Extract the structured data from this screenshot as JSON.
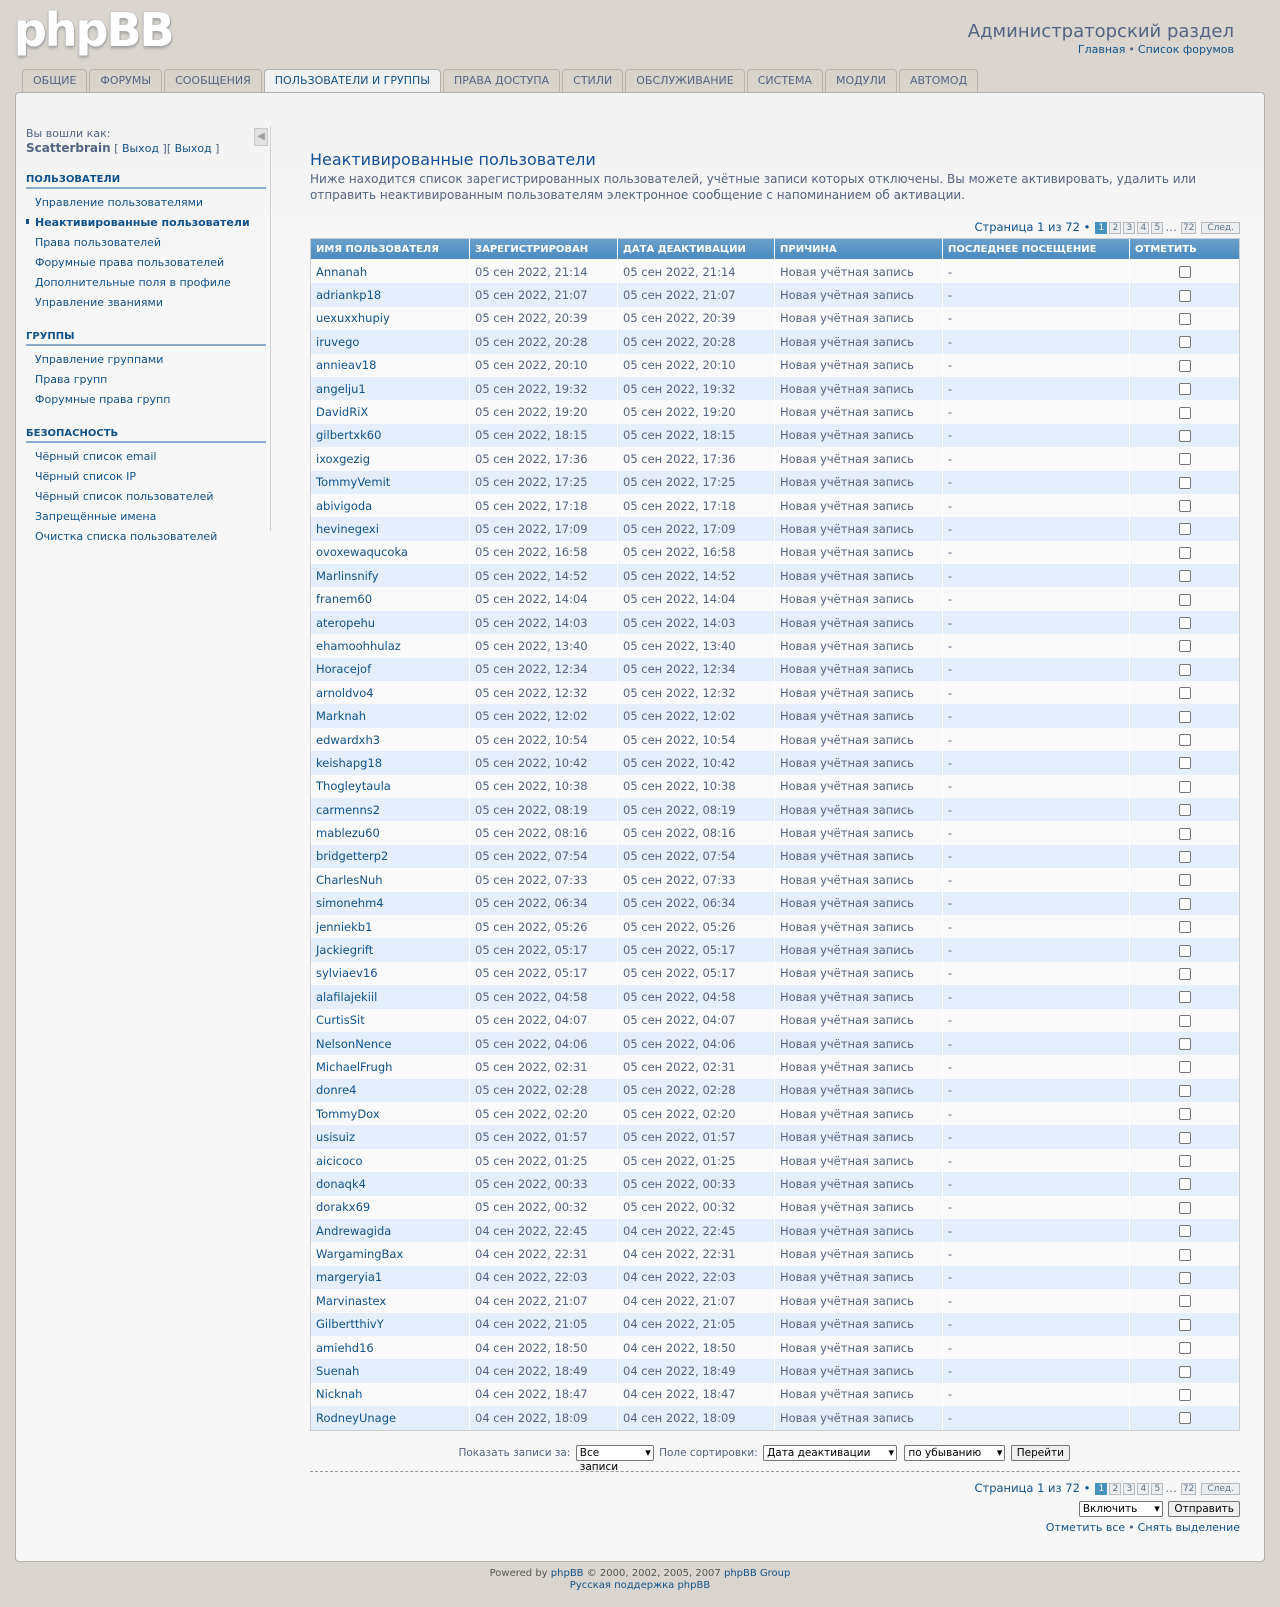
{
  "header": {
    "logo": "phpBB",
    "title": "Администраторский раздел",
    "links": [
      "Главная",
      "Список форумов"
    ]
  },
  "tabs": [
    "Общие",
    "Форумы",
    "Сообщения",
    "Пользователи и группы",
    "Права доступа",
    "Стили",
    "Обслуживание",
    "Система",
    "Модули",
    "Автомод"
  ],
  "active_tab": 3,
  "sidebar": {
    "logged_in_label": "Вы вошли как:",
    "username": "Scatterbrain",
    "logout_1": "Выход",
    "logout_2": "Выход",
    "sections": [
      {
        "title": "Пользователи",
        "items": [
          "Управление пользователями",
          "Неактивированные пользователи",
          "Права пользователей",
          "Форумные права пользователей",
          "Дополнительные поля в профиле",
          "Управление званиями"
        ]
      },
      {
        "title": "Группы",
        "items": [
          "Управление группами",
          "Права групп",
          "Форумные права групп"
        ]
      },
      {
        "title": "Безопасность",
        "items": [
          "Чёрный список email",
          "Чёрный список IP",
          "Чёрный список пользователей",
          "Запрещённые имена",
          "Очистка списка пользователей"
        ]
      }
    ],
    "active_item": "Неактивированные пользователи"
  },
  "main": {
    "title": "Неактивированные пользователи",
    "description": "Ниже находится список зарегистрированных пользователей, учётные записи которых отключены. Вы можете активировать, удалить или отправить неактивированным пользователям электронное сообщение с напоминанием об активации.",
    "pagination": {
      "label": "Страница 1 из 72 •",
      "pages": [
        "1",
        "2",
        "3",
        "4",
        "5"
      ],
      "dots": "…",
      "last": "72",
      "next": "След."
    },
    "columns": [
      "Имя пользователя",
      "Зарегистрирован",
      "Дата деактивации",
      "Причина",
      "Последнее посещение",
      "Отметить"
    ],
    "rows": [
      [
        "Annanah",
        "05 сен 2022, 21:14",
        "05 сен 2022, 21:14",
        "Новая учётная запись",
        "-"
      ],
      [
        "adriankp18",
        "05 сен 2022, 21:07",
        "05 сен 2022, 21:07",
        "Новая учётная запись",
        "-"
      ],
      [
        "uexuxxhupiy",
        "05 сен 2022, 20:39",
        "05 сен 2022, 20:39",
        "Новая учётная запись",
        "-"
      ],
      [
        "iruvego",
        "05 сен 2022, 20:28",
        "05 сен 2022, 20:28",
        "Новая учётная запись",
        "-"
      ],
      [
        "annieav18",
        "05 сен 2022, 20:10",
        "05 сен 2022, 20:10",
        "Новая учётная запись",
        "-"
      ],
      [
        "angelju1",
        "05 сен 2022, 19:32",
        "05 сен 2022, 19:32",
        "Новая учётная запись",
        "-"
      ],
      [
        "DavidRiX",
        "05 сен 2022, 19:20",
        "05 сен 2022, 19:20",
        "Новая учётная запись",
        "-"
      ],
      [
        "gilbertxk60",
        "05 сен 2022, 18:15",
        "05 сен 2022, 18:15",
        "Новая учётная запись",
        "-"
      ],
      [
        "ixoxgezig",
        "05 сен 2022, 17:36",
        "05 сен 2022, 17:36",
        "Новая учётная запись",
        "-"
      ],
      [
        "TommyVemit",
        "05 сен 2022, 17:25",
        "05 сен 2022, 17:25",
        "Новая учётная запись",
        "-"
      ],
      [
        "abivigoda",
        "05 сен 2022, 17:18",
        "05 сен 2022, 17:18",
        "Новая учётная запись",
        "-"
      ],
      [
        "hevinegexi",
        "05 сен 2022, 17:09",
        "05 сен 2022, 17:09",
        "Новая учётная запись",
        "-"
      ],
      [
        "ovoxewaqucoka",
        "05 сен 2022, 16:58",
        "05 сен 2022, 16:58",
        "Новая учётная запись",
        "-"
      ],
      [
        "Marlinsnify",
        "05 сен 2022, 14:52",
        "05 сен 2022, 14:52",
        "Новая учётная запись",
        "-"
      ],
      [
        "franem60",
        "05 сен 2022, 14:04",
        "05 сен 2022, 14:04",
        "Новая учётная запись",
        "-"
      ],
      [
        "ateropehu",
        "05 сен 2022, 14:03",
        "05 сен 2022, 14:03",
        "Новая учётная запись",
        "-"
      ],
      [
        "ehamoohhulaz",
        "05 сен 2022, 13:40",
        "05 сен 2022, 13:40",
        "Новая учётная запись",
        "-"
      ],
      [
        "Horacejof",
        "05 сен 2022, 12:34",
        "05 сен 2022, 12:34",
        "Новая учётная запись",
        "-"
      ],
      [
        "arnoldvo4",
        "05 сен 2022, 12:32",
        "05 сен 2022, 12:32",
        "Новая учётная запись",
        "-"
      ],
      [
        "Marknah",
        "05 сен 2022, 12:02",
        "05 сен 2022, 12:02",
        "Новая учётная запись",
        "-"
      ],
      [
        "edwardxh3",
        "05 сен 2022, 10:54",
        "05 сен 2022, 10:54",
        "Новая учётная запись",
        "-"
      ],
      [
        "keishapg18",
        "05 сен 2022, 10:42",
        "05 сен 2022, 10:42",
        "Новая учётная запись",
        "-"
      ],
      [
        "Thogleytaula",
        "05 сен 2022, 10:38",
        "05 сен 2022, 10:38",
        "Новая учётная запись",
        "-"
      ],
      [
        "carmenns2",
        "05 сен 2022, 08:19",
        "05 сен 2022, 08:19",
        "Новая учётная запись",
        "-"
      ],
      [
        "mablezu60",
        "05 сен 2022, 08:16",
        "05 сен 2022, 08:16",
        "Новая учётная запись",
        "-"
      ],
      [
        "bridgetterp2",
        "05 сен 2022, 07:54",
        "05 сен 2022, 07:54",
        "Новая учётная запись",
        "-"
      ],
      [
        "CharlesNuh",
        "05 сен 2022, 07:33",
        "05 сен 2022, 07:33",
        "Новая учётная запись",
        "-"
      ],
      [
        "simonehm4",
        "05 сен 2022, 06:34",
        "05 сен 2022, 06:34",
        "Новая учётная запись",
        "-"
      ],
      [
        "jenniekb1",
        "05 сен 2022, 05:26",
        "05 сен 2022, 05:26",
        "Новая учётная запись",
        "-"
      ],
      [
        "Jackiegrift",
        "05 сен 2022, 05:17",
        "05 сен 2022, 05:17",
        "Новая учётная запись",
        "-"
      ],
      [
        "sylviaev16",
        "05 сен 2022, 05:17",
        "05 сен 2022, 05:17",
        "Новая учётная запись",
        "-"
      ],
      [
        "alafilajekiil",
        "05 сен 2022, 04:58",
        "05 сен 2022, 04:58",
        "Новая учётная запись",
        "-"
      ],
      [
        "CurtisSit",
        "05 сен 2022, 04:07",
        "05 сен 2022, 04:07",
        "Новая учётная запись",
        "-"
      ],
      [
        "NelsonNence",
        "05 сен 2022, 04:06",
        "05 сен 2022, 04:06",
        "Новая учётная запись",
        "-"
      ],
      [
        "MichaelFrugh",
        "05 сен 2022, 02:31",
        "05 сен 2022, 02:31",
        "Новая учётная запись",
        "-"
      ],
      [
        "donre4",
        "05 сен 2022, 02:28",
        "05 сен 2022, 02:28",
        "Новая учётная запись",
        "-"
      ],
      [
        "TommyDox",
        "05 сен 2022, 02:20",
        "05 сен 2022, 02:20",
        "Новая учётная запись",
        "-"
      ],
      [
        "usisuiz",
        "05 сен 2022, 01:57",
        "05 сен 2022, 01:57",
        "Новая учётная запись",
        "-"
      ],
      [
        "aicicoco",
        "05 сен 2022, 01:25",
        "05 сен 2022, 01:25",
        "Новая учётная запись",
        "-"
      ],
      [
        "donaqk4",
        "05 сен 2022, 00:33",
        "05 сен 2022, 00:33",
        "Новая учётная запись",
        "-"
      ],
      [
        "dorakx69",
        "05 сен 2022, 00:32",
        "05 сен 2022, 00:32",
        "Новая учётная запись",
        "-"
      ],
      [
        "Andrewagida",
        "04 сен 2022, 22:45",
        "04 сен 2022, 22:45",
        "Новая учётная запись",
        "-"
      ],
      [
        "WargamingBax",
        "04 сен 2022, 22:31",
        "04 сен 2022, 22:31",
        "Новая учётная запись",
        "-"
      ],
      [
        "margeryia1",
        "04 сен 2022, 22:03",
        "04 сен 2022, 22:03",
        "Новая учётная запись",
        "-"
      ],
      [
        "Marvinastex",
        "04 сен 2022, 21:07",
        "04 сен 2022, 21:07",
        "Новая учётная запись",
        "-"
      ],
      [
        "GilbertthivY",
        "04 сен 2022, 21:05",
        "04 сен 2022, 21:05",
        "Новая учётная запись",
        "-"
      ],
      [
        "amiehd16",
        "04 сен 2022, 18:50",
        "04 сен 2022, 18:50",
        "Новая учётная запись",
        "-"
      ],
      [
        "Suenah",
        "04 сен 2022, 18:49",
        "04 сен 2022, 18:49",
        "Новая учётная запись",
        "-"
      ],
      [
        "Nicknah",
        "04 сен 2022, 18:47",
        "04 сен 2022, 18:47",
        "Новая учётная запись",
        "-"
      ],
      [
        "RodneyUnage",
        "04 сен 2022, 18:09",
        "04 сен 2022, 18:09",
        "Новая учётная запись",
        "-"
      ]
    ],
    "filter": {
      "show_label": "Показать записи за:",
      "show_value": "Все записи",
      "sort_label": "Поле сортировки:",
      "sort_value": "Дата деактивации",
      "order_value": "по убыванию",
      "go_button": "Перейти"
    },
    "action": {
      "select_value": "Включить",
      "submit_button": "Отправить"
    },
    "mark_all": "Отметить все",
    "unmark_all": "Снять выделение"
  },
  "footer": {
    "powered_prefix": "Powered by",
    "powered_link": "phpBB",
    "copyright": "© 2000, 2002, 2005, 2007",
    "group_link": "phpBB Group",
    "support_link": "Русская поддержка phpBB"
  }
}
